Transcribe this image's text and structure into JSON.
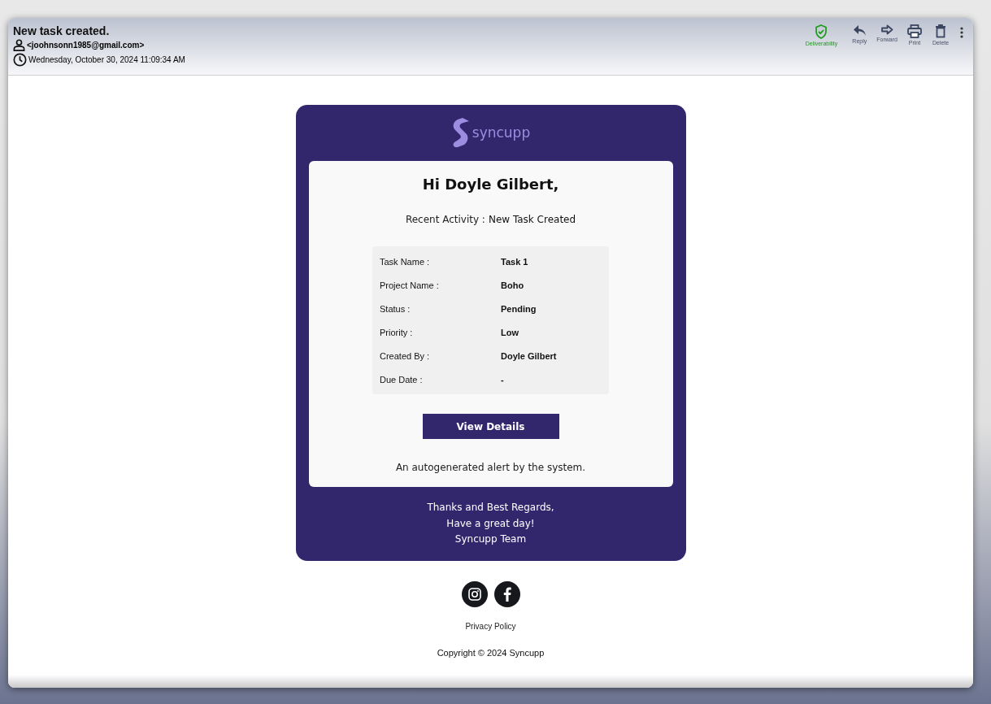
{
  "email": {
    "subject": "New task created.",
    "sender": "<joohnsonn1985@gmail.com>",
    "date": "Wednesday, October 30, 2024 11:09:34 AM"
  },
  "toolbar": [
    {
      "kind": "deliverability",
      "label": "Deliverability"
    },
    {
      "kind": "reply",
      "label": "Reply"
    },
    {
      "kind": "forward",
      "label": "Forward"
    },
    {
      "kind": "print",
      "label": "Print"
    },
    {
      "kind": "delete",
      "label": "Delete"
    },
    {
      "kind": "more"
    }
  ],
  "message": {
    "logo": "syncupp",
    "greeting": "Hi Doyle Gilbert,",
    "activity_label": "Recent Activity :",
    "activity_value": "New Task Created",
    "details": [
      {
        "label": "Task Name :",
        "value": "Task 1"
      },
      {
        "label": "Project Name :",
        "value": "Boho"
      },
      {
        "label": "Status :",
        "value": "Pending"
      },
      {
        "label": "Priority :",
        "value": "Low"
      },
      {
        "label": "Created By :",
        "value": "Doyle Gilbert"
      },
      {
        "label": "Due Date :",
        "value": "-"
      }
    ],
    "button": "View Details",
    "note": "An autogenerated alert by the system.",
    "signoff": [
      "Thanks and Best Regards,",
      "Have a great day!",
      "Syncupp Team"
    ]
  },
  "footer": {
    "social": [
      {
        "kind": "instagram"
      },
      {
        "kind": "facebook"
      }
    ],
    "privacy": "Privacy Policy",
    "copyright": "Copyright © 2024 Syncupp"
  }
}
